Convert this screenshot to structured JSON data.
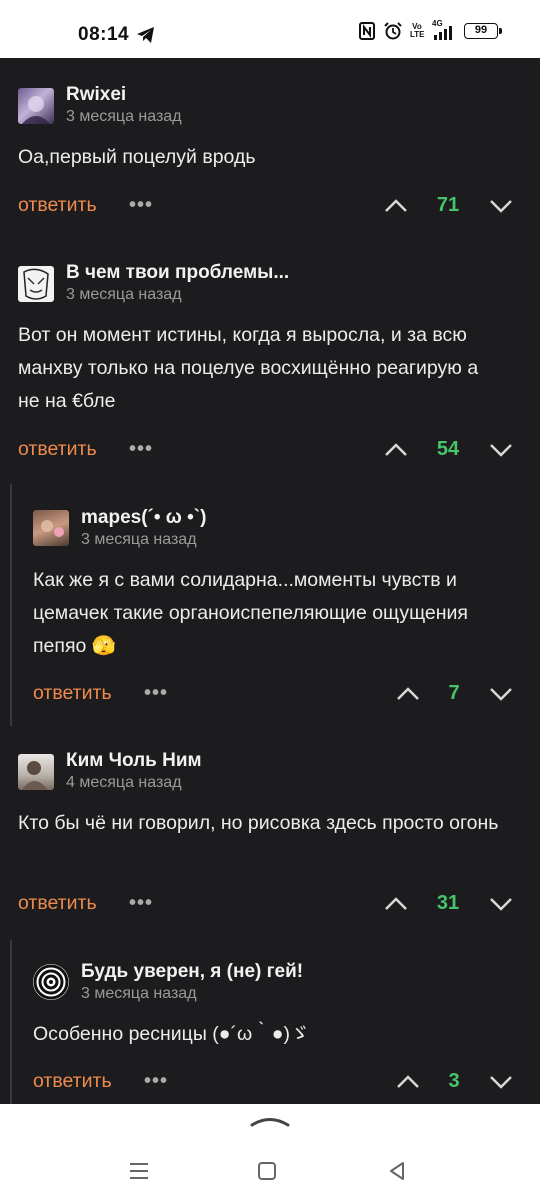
{
  "status": {
    "time": "08:14",
    "volte_top": "Vo",
    "volte_bottom": "LTE",
    "network": "4G",
    "battery": "99"
  },
  "reply_label": "ответить",
  "more_label": "•••",
  "comments": [
    {
      "user": "Rwixei",
      "date": "3 месяца назад",
      "text": "Оа,первый поцелуй вродь",
      "score": "71"
    },
    {
      "user": "В чем твои проблемы...",
      "date": "3 месяца назад",
      "text": "Вот он момент истины, когда я выросла, и за всю манхву только на поцелуе восхищённо реагирую а не на €бле",
      "score": "54"
    },
    {
      "user": "mapes(´• ω •`)",
      "date": "3 месяца назад",
      "text": "Как же я с вами солидарна...моменты чувств и цемачек такие органоиспепеляющие ощущения пепяо 🫣",
      "score": "7"
    },
    {
      "user": "Ким Чоль Ним",
      "date": "4 месяца назад",
      "text": "Кто бы чё ни говорил, но рисовка здесь просто огонь",
      "score": "31"
    },
    {
      "user": "Будь уверен, я (не) гей!",
      "date": "3 месяца назад",
      "text": "Особенно ресницы (●´ω｀●)ゞ",
      "score": "3"
    }
  ]
}
